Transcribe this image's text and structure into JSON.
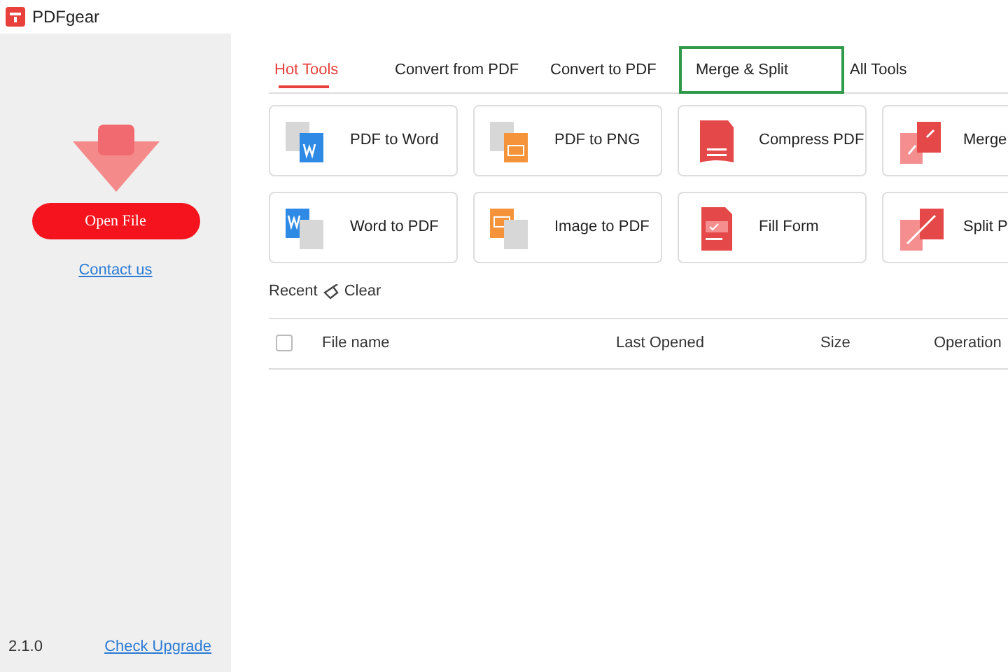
{
  "window": {
    "title": "PDFgear"
  },
  "sidebar": {
    "open_button": "Open File",
    "contact_link": "Contact us",
    "version": "2.1.0",
    "upgrade_link": "Check Upgrade"
  },
  "tabs": [
    {
      "label": "Hot Tools",
      "selected": true,
      "highlighted": false
    },
    {
      "label": "Convert from PDF",
      "selected": false,
      "highlighted": false
    },
    {
      "label": "Convert to PDF",
      "selected": false,
      "highlighted": false
    },
    {
      "label": "Merge & Split",
      "selected": false,
      "highlighted": true
    },
    {
      "label": "All Tools",
      "selected": false,
      "highlighted": false
    }
  ],
  "tools": [
    {
      "label": "PDF to Word",
      "kind": "pdf-word"
    },
    {
      "label": "PDF to PNG",
      "kind": "pdf-image"
    },
    {
      "label": "Compress PDF",
      "kind": "compress"
    },
    {
      "label": "Merge",
      "kind": "merge"
    },
    {
      "label": "Word to PDF",
      "kind": "word-pdf"
    },
    {
      "label": "Image to PDF",
      "kind": "image-pdf"
    },
    {
      "label": "Fill Form",
      "kind": "form"
    },
    {
      "label": "Split P",
      "kind": "split"
    }
  ],
  "recent": {
    "title": "Recent",
    "clear": "Clear"
  },
  "table": {
    "select_all_checked": false,
    "columns": [
      "File name",
      "Last Opened",
      "Size",
      "Operation"
    ]
  }
}
